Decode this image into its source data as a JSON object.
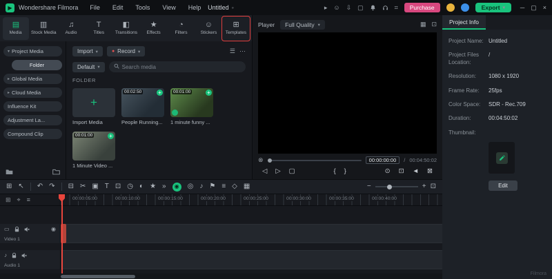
{
  "icons": {
    "dropdown": "▾",
    "chevron_right": "▸",
    "chevron_down": "▾",
    "more": "⋯",
    "plus": "+",
    "record_dot": "●",
    "unsaved": "◦",
    "share": "▸",
    "emoji": "☺",
    "download": "⇩",
    "screen": "▢",
    "apps": "⌗",
    "minimize": "─",
    "maximize": "▢",
    "close": "×",
    "sort": "☰",
    "grid_view": "▦",
    "pip": "⊡",
    "progress_marker": "⊗",
    "logo_glyph": "▶",
    "eye": "◉"
  },
  "titlebar": {
    "app_name": "Wondershare Filmora",
    "menus": [
      "File",
      "Edit",
      "Tools",
      "View",
      "Help"
    ],
    "document_title": "Untitled",
    "purchase_label": "Purchase",
    "export_label": "Export"
  },
  "tabs": {
    "items": [
      {
        "label": "Media",
        "glyph": "▤"
      },
      {
        "label": "Stock Media",
        "glyph": "▥"
      },
      {
        "label": "Audio",
        "glyph": "♫"
      },
      {
        "label": "Titles",
        "glyph": "T"
      },
      {
        "label": "Transitions",
        "glyph": "◧"
      },
      {
        "label": "Effects",
        "glyph": "★"
      },
      {
        "label": "Filters",
        "glyph": "◔"
      },
      {
        "label": "Stickers",
        "glyph": "☺"
      },
      {
        "label": "Templates",
        "glyph": "⊞"
      }
    ]
  },
  "sidebar": {
    "items": [
      {
        "label": "Project Media"
      },
      {
        "label": "Folder"
      },
      {
        "label": "Global Media"
      },
      {
        "label": "Cloud Media"
      },
      {
        "label": "Influence Kit"
      },
      {
        "label": "Adjustment La..."
      },
      {
        "label": "Compound Clip"
      }
    ]
  },
  "media_panel": {
    "import_label": "Import",
    "record_label": "Record",
    "sort_label": "Default",
    "search_placeholder": "Search media",
    "section_label": "FOLDER",
    "tiles": [
      {
        "label": "Import Media"
      },
      {
        "label": "People Running...",
        "duration": "00:02:50"
      },
      {
        "label": "1 minute funny ...",
        "duration": "00:01:00"
      },
      {
        "label": "1 Minute Video ...",
        "duration": "00:01:00"
      }
    ]
  },
  "player": {
    "label": "Player",
    "quality": "Full Quality",
    "current_time": "00:00:00:00",
    "time_separator": "/",
    "total_time": "00:04:50:02",
    "transport": [
      {
        "name": "previous-frame",
        "glyph": "◁"
      },
      {
        "name": "play",
        "glyph": "▷"
      },
      {
        "name": "stop",
        "glyph": "▢"
      },
      {
        "name": "mark-in",
        "glyph": "{"
      },
      {
        "name": "mark-out",
        "glyph": "}"
      },
      {
        "name": "snapshot",
        "glyph": "⊙"
      },
      {
        "name": "crop",
        "glyph": "⊡"
      },
      {
        "name": "volume",
        "glyph": "◄"
      },
      {
        "name": "fullscreen",
        "glyph": "⊠"
      }
    ]
  },
  "toolbar": {
    "icons": [
      {
        "name": "workspace",
        "glyph": "⊞"
      },
      {
        "name": "select-tool",
        "glyph": "↖"
      },
      {
        "name": "undo",
        "glyph": "↶"
      },
      {
        "name": "redo",
        "glyph": "↷"
      },
      {
        "name": "delete",
        "glyph": "⊟"
      },
      {
        "name": "split",
        "glyph": "✂"
      },
      {
        "name": "copy",
        "glyph": "▣"
      },
      {
        "name": "text-tool",
        "glyph": "T"
      },
      {
        "name": "crop",
        "glyph": "⊡"
      },
      {
        "name": "speed",
        "glyph": "◷"
      },
      {
        "name": "color",
        "glyph": "◐"
      },
      {
        "name": "ai-tools",
        "glyph": "★"
      },
      {
        "name": "more-tools",
        "glyph": "»"
      },
      {
        "name": "smart-edit",
        "glyph": "◉"
      },
      {
        "name": "mask",
        "glyph": "◎"
      },
      {
        "name": "voiceover",
        "glyph": "♪"
      },
      {
        "name": "marker",
        "glyph": "⚑"
      },
      {
        "name": "mixer",
        "glyph": "≡"
      },
      {
        "name": "keyframe",
        "glyph": "◇"
      },
      {
        "name": "render-preview",
        "glyph": "▦"
      }
    ],
    "zoom_out": "−",
    "zoom_in": "+",
    "fit": "⊡"
  },
  "timeline": {
    "corner_icons": [
      {
        "name": "manage-tracks",
        "glyph": "⊞"
      },
      {
        "name": "snap",
        "glyph": "⌖"
      },
      {
        "name": "ripple",
        "glyph": "≡"
      }
    ],
    "ruler": [
      "00:00:05:00",
      "00:00:10:00",
      "00:00:15:00",
      "00:00:20:00",
      "00:00:25:00",
      "00:00:30:00",
      "00:00:35:00",
      "00:00:40:00"
    ],
    "tracks": [
      {
        "name": "Video 1",
        "type_glyph": "▭"
      },
      {
        "name": "Audio 1",
        "type_glyph": "♪"
      }
    ]
  },
  "project_info": {
    "tab_label": "Project Info",
    "fields": [
      {
        "label": "Project Name:",
        "value": "Untitled"
      },
      {
        "label": "Project Files Location:",
        "value": "/"
      },
      {
        "label": "Resolution:",
        "value": "1080 x 1920"
      },
      {
        "label": "Frame Rate:",
        "value": "25fps"
      },
      {
        "label": "Color Space:",
        "value": "SDR - Rec.709"
      },
      {
        "label": "Duration:",
        "value": "00:04:50:02"
      },
      {
        "label": "Thumbnail:",
        "value": ""
      }
    ],
    "edit_label": "Edit",
    "watermark": "Filmora"
  },
  "colors": {
    "accent_teal": "#19c37d",
    "purchase_pink": "#d8487f",
    "highlight_red": "#e03e3e",
    "playhead_red": "#e8453c"
  }
}
